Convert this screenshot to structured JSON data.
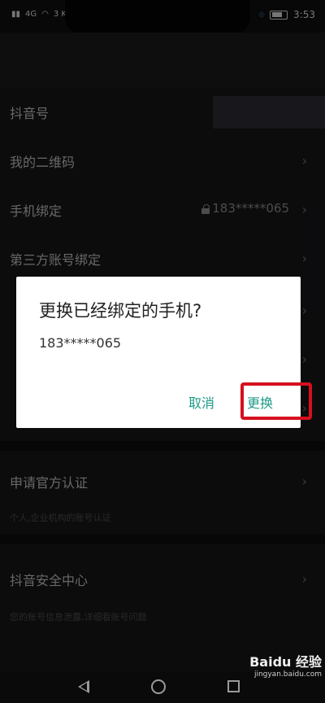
{
  "status_bar": {
    "signal_text": "4G",
    "speed": "3 K/s",
    "time": "3:53"
  },
  "settings": {
    "items": [
      {
        "label": "抖音号",
        "value": ""
      },
      {
        "label": "我的二维码"
      },
      {
        "label": "手机绑定",
        "value": "183*****065"
      },
      {
        "label": "第三方账号绑定"
      },
      {
        "label": "申请官方认证",
        "sub": "个人,企业机构的账号认证"
      },
      {
        "label": "抖音安全中心",
        "sub": "您的账号信息泄露,详细看账号问题"
      }
    ]
  },
  "dialog": {
    "title": "更换已经绑定的手机?",
    "phone": "183*****065",
    "cancel_label": "取消",
    "confirm_label": "更换"
  },
  "watermark": {
    "logo": "Baidu 经验",
    "url": "jingyan.baidu.com"
  },
  "colors": {
    "accent": "#1e9a87",
    "highlight": "#d6101e"
  }
}
